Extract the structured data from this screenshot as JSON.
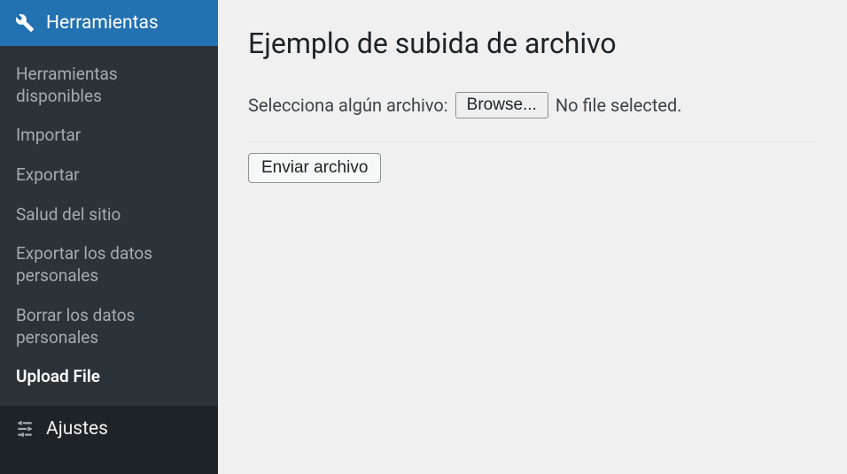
{
  "sidebar": {
    "header_label": "Herramientas",
    "items": [
      {
        "label": "Herramientas disponibles"
      },
      {
        "label": "Importar"
      },
      {
        "label": "Exportar"
      },
      {
        "label": "Salud del sitio"
      },
      {
        "label": "Exportar los datos personales"
      },
      {
        "label": "Borrar los datos personales"
      },
      {
        "label": "Upload File"
      }
    ],
    "settings_label": "Ajustes"
  },
  "main": {
    "title": "Ejemplo de subida de archivo",
    "file_label": "Selecciona algún archivo:",
    "browse_label": "Browse...",
    "file_status": "No file selected.",
    "submit_label": "Enviar archivo"
  }
}
